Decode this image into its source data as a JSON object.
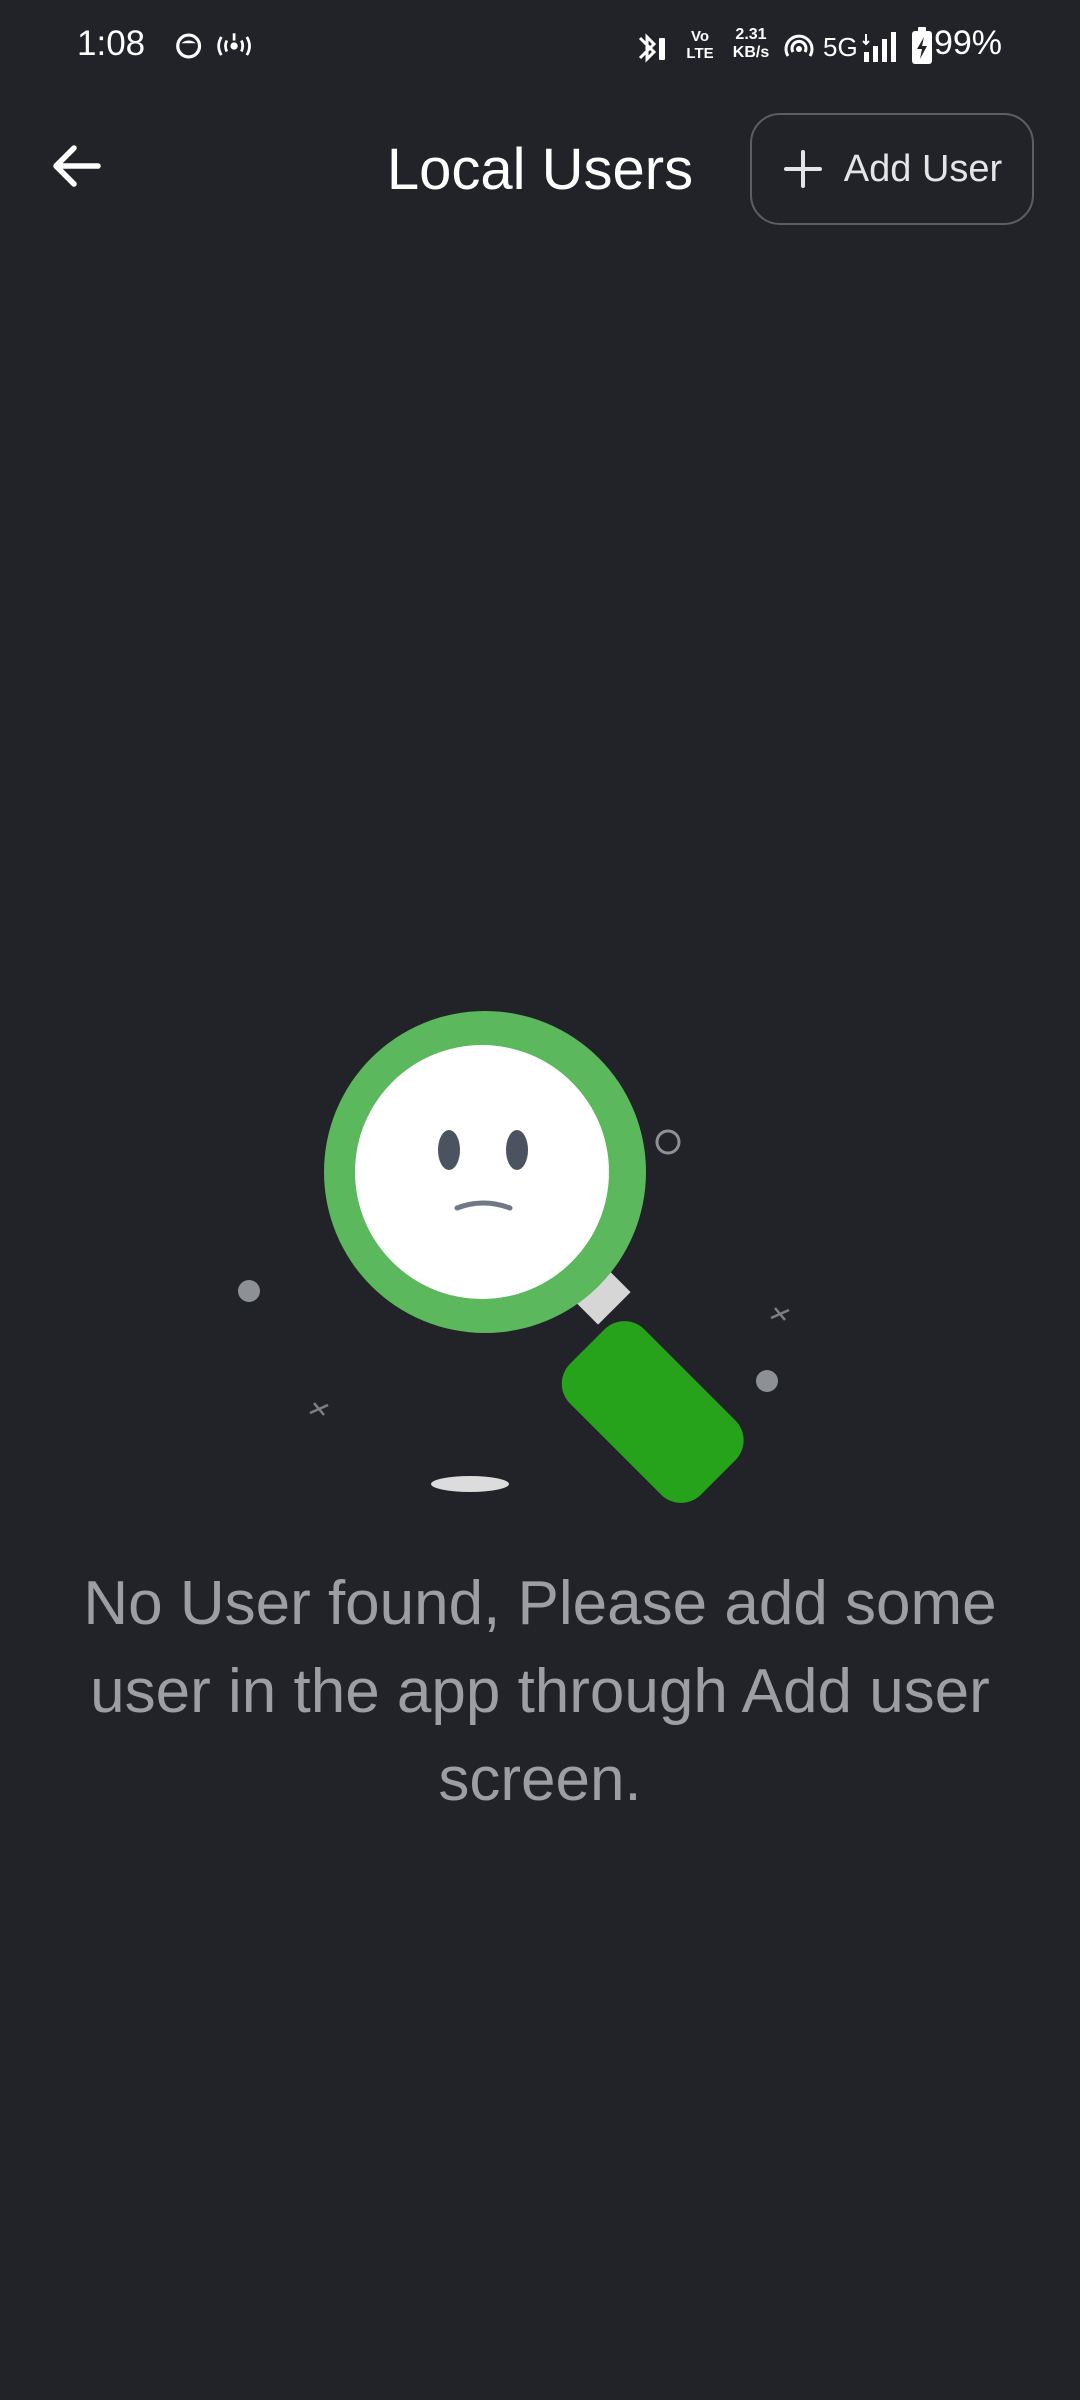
{
  "status_bar": {
    "time": "1:08",
    "speed_value": "2.31",
    "speed_unit": "KB/s",
    "volte_label_top": "Vo",
    "volte_label_bottom": "LTE",
    "network_type": "5G",
    "battery_percent": "99%"
  },
  "app_bar": {
    "title": "Local Users",
    "add_user_label": "Add User"
  },
  "empty_state": {
    "message": "No User found, Please add some user in the app through Add user screen."
  },
  "colors": {
    "background": "#212328",
    "accent_green": "#5cb85c",
    "handle_green": "#26a31a",
    "text_muted": "#9c9ea2"
  }
}
